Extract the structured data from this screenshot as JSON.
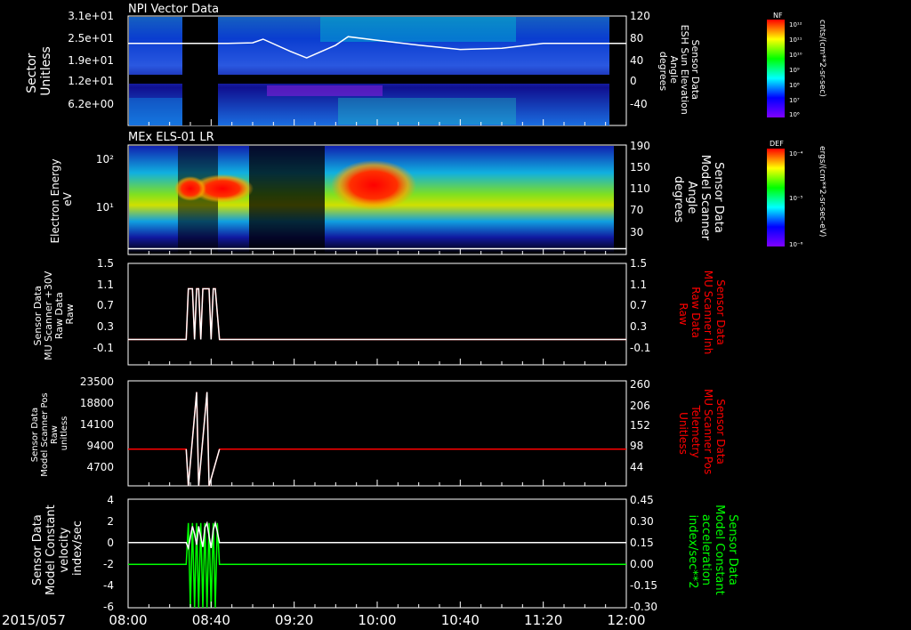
{
  "date_label": "2015/057",
  "time_ticks": [
    "08:00",
    "08:40",
    "09:20",
    "10:00",
    "10:40",
    "11:20",
    "12:00"
  ],
  "colors": {
    "bg": "#000000",
    "fg": "#ffffff",
    "red": "#ff0000",
    "green": "#00ff00"
  },
  "colorbars": [
    {
      "tag": "NF",
      "unit": "cnts/(cm**2-sr-sec)",
      "ticks": [
        "10¹²",
        "10¹¹",
        "10¹⁰",
        "10⁹",
        "10⁸",
        "10⁷",
        "10⁶"
      ]
    },
    {
      "tag": "DEF",
      "unit": "ergs/(cm**2-sr-sec-eV)",
      "ticks": [
        "10⁻⁴",
        "10⁻⁵",
        "10⁻⁶"
      ]
    }
  ],
  "chart_data": [
    {
      "type": "heatmap",
      "title": "NPI Vector Data",
      "ylabel": "Sector\nUnitless",
      "yticks": [
        "3.1e+01",
        "2.5e+01",
        "1.9e+01",
        "1.2e+01",
        "6.2e+00"
      ],
      "y2label": "Sensor Data\nESH Sun Elevation\nAngle\ndegrees",
      "y2ticks": [
        "120",
        "80",
        "40",
        "0",
        "-40"
      ],
      "colorbar": "NF",
      "overlay": {
        "name": "ESH Sun Elevation Angle",
        "color": "#ffffff",
        "x": [
          "08:00",
          "08:38",
          "08:48",
          "09:00",
          "09:05",
          "09:18",
          "09:26",
          "09:40",
          "09:46",
          "10:00",
          "10:20",
          "10:40",
          "11:00",
          "11:20",
          "12:00"
        ],
        "y": [
          75,
          75,
          75,
          76,
          82,
          62,
          51,
          72,
          86,
          80,
          72,
          65,
          67,
          75,
          75
        ]
      }
    },
    {
      "type": "heatmap",
      "title": "MEx ELS-01 LR",
      "ylabel": "Electron Energy\neV",
      "yticks": [
        "10²",
        "10¹"
      ],
      "y2label": "Sensor Data\nModel Scanner\nAngle\ndegrees",
      "y2ticks": [
        "190",
        "150",
        "110",
        "70",
        "30"
      ],
      "colorbar": "DEF",
      "overlay": {
        "name": "Model Scanner Angle",
        "color": "#ffffff",
        "x": [
          "08:00",
          "08:30",
          "12:00"
        ],
        "y": [
          10,
          10,
          10
        ]
      }
    },
    {
      "type": "line",
      "ylabel": "Sensor Data\nMU Scanner +30V\nRaw Data\nRaw",
      "ylim": [
        -0.5,
        1.5
      ],
      "yticks": [
        "1.5",
        "1.1",
        "0.7",
        "0.3",
        "-0.1"
      ],
      "y2label": "Sensor Data\nMU Scanner Inh\nRaw Data\nRaw",
      "y2ticks": [
        "1.5",
        "1.1",
        "0.7",
        "0.3",
        "-0.1"
      ],
      "series": [
        {
          "name": "MU Scanner Inh",
          "color": "#ff0000",
          "x": [
            "08:00",
            "08:28",
            "08:29",
            "08:31",
            "08:32",
            "08:33",
            "08:34",
            "08:35",
            "08:36",
            "08:37",
            "08:39",
            "08:40",
            "08:41",
            "08:42",
            "08:44",
            "08:45",
            "12:00"
          ],
          "y": [
            0,
            0,
            1,
            1,
            0,
            1,
            1,
            0,
            1,
            1,
            1,
            0,
            1,
            1,
            0,
            0,
            0
          ]
        },
        {
          "name": "MU Scanner +30V",
          "color": "#ffffff",
          "x": [
            "08:00",
            "08:28",
            "08:29",
            "08:31",
            "08:32",
            "08:33",
            "08:34",
            "08:35",
            "08:36",
            "08:37",
            "08:39",
            "08:40",
            "08:41",
            "08:42",
            "08:44",
            "08:45",
            "12:00"
          ],
          "y": [
            0,
            0,
            1,
            1,
            0,
            1,
            1,
            0,
            1,
            1,
            1,
            0,
            1,
            1,
            0,
            0,
            0
          ]
        }
      ]
    },
    {
      "type": "line",
      "ylabel": "Sensor Data\nModel Scanner Pos\nRaw\nunitless",
      "ylim": [
        0,
        23500
      ],
      "yticks": [
        "23500",
        "18800",
        "14100",
        "9400",
        "4700"
      ],
      "y2label": "Sensor Data\nMU Scanner Pos\nTelemetry\nUnitless",
      "y2ticks": [
        "260",
        "206",
        "152",
        "98",
        "44"
      ],
      "series": [
        {
          "name": "MU Scanner Pos",
          "color": "#ff0000",
          "x": [
            "08:00",
            "08:28",
            "08:29",
            "08:33",
            "08:34",
            "08:38",
            "08:39",
            "08:44",
            "08:45",
            "12:00"
          ],
          "y": [
            8200,
            8200,
            0,
            21000,
            0,
            21000,
            0,
            8200,
            8200,
            8200
          ]
        },
        {
          "name": "Model Scanner Pos",
          "color": "#ffffff",
          "x": [
            "08:28",
            "08:29",
            "08:33",
            "08:34",
            "08:38",
            "08:39",
            "08:44"
          ],
          "y": [
            8200,
            0,
            21000,
            0,
            21000,
            0,
            8200
          ]
        }
      ]
    },
    {
      "type": "line",
      "ylabel": "Sensor Data\nModel Constant\nvelocity\nindex/sec",
      "ylim": [
        -6,
        4
      ],
      "yticks": [
        "4",
        "2",
        "0",
        "-2",
        "-4",
        "-6"
      ],
      "y2label": "Sensor Data\nModel Constant\nacceleration\nindex/sec**2",
      "y2ticks": [
        "0.45",
        "0.30",
        "0.15",
        "0.00",
        "-0.15",
        "-0.30"
      ],
      "series": [
        {
          "name": "Model Constant velocity",
          "color": "#ffffff",
          "x": [
            "08:00",
            "08:28",
            "08:29",
            "08:30",
            "08:31",
            "08:32",
            "08:33",
            "08:34",
            "08:35",
            "08:36",
            "08:37",
            "08:38",
            "08:39",
            "08:40",
            "08:41",
            "08:42",
            "08:43",
            "08:44",
            "08:45",
            "12:00"
          ],
          "y": [
            0,
            0,
            -0.5,
            0.5,
            1.5,
            0.8,
            -0.2,
            1.5,
            0.5,
            -0.4,
            1.4,
            1.8,
            0.6,
            -0.5,
            1.2,
            1.8,
            1.0,
            0,
            0,
            0
          ]
        },
        {
          "name": "Model Constant acceleration",
          "color": "#00ff00",
          "x": [
            "08:00",
            "08:28",
            "08:29",
            "08:30",
            "08:31",
            "08:32",
            "08:33",
            "08:34",
            "08:35",
            "08:36",
            "08:37",
            "08:38",
            "08:39",
            "08:40",
            "08:41",
            "08:42",
            "08:43",
            "08:44",
            "08:45",
            "12:00"
          ],
          "y": [
            -2,
            -2,
            1.8,
            -6,
            1.8,
            -6,
            1.8,
            -6,
            1.8,
            -6,
            1.8,
            -6,
            1.8,
            -6,
            1.8,
            -6,
            1.8,
            -2,
            -2,
            -2
          ]
        }
      ]
    }
  ]
}
